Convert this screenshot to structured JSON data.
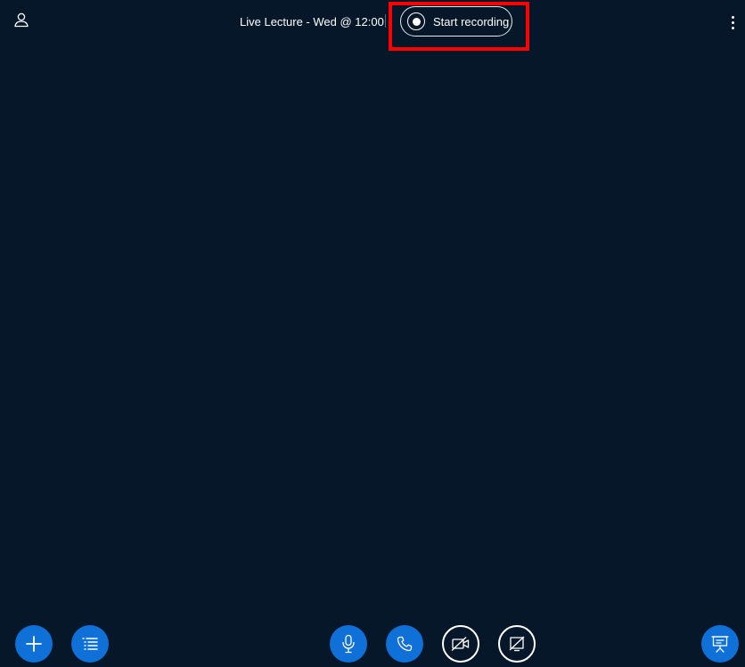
{
  "topbar": {
    "title": "Live Lecture - Wed @ 12:00",
    "record_label": "Start recording",
    "user_icon": "user-icon",
    "record_icon": "record-icon",
    "more_icon": "more-vertical-icon"
  },
  "bottombar": {
    "actions_icon": "plus-icon",
    "list_icon": "list-icon",
    "mic_icon": "microphone-icon",
    "phone_icon": "phone-icon",
    "camera_icon": "video-off-icon",
    "screen_icon": "screen-share-off-icon",
    "presentation_icon": "presentation-icon"
  },
  "colors": {
    "background": "#06172a",
    "accent": "#0f70d7",
    "highlight": "#ff0000"
  }
}
